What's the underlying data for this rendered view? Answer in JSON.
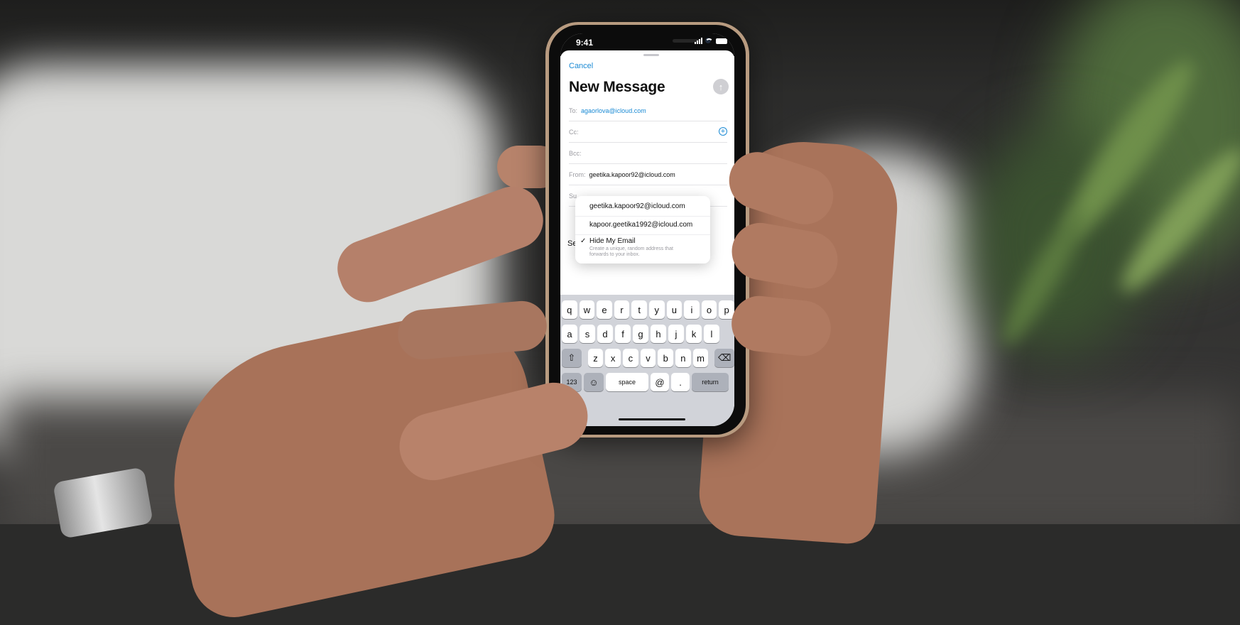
{
  "status_bar": {
    "time": "9:41"
  },
  "compose": {
    "cancel_label": "Cancel",
    "title": "New Message",
    "send_icon": "arrow-up-icon",
    "to_label": "To:",
    "to_value": "agaorlova@icloud.com",
    "cc_label": "Cc:",
    "bcc_label": "Bcc:",
    "from_label": "From:",
    "from_value": "geetika.kapoor92@icloud.com",
    "subject_label": "Su",
    "body_stub": "Se"
  },
  "from_menu": {
    "options": [
      {
        "label": "geetika.kapoor92@icloud.com"
      },
      {
        "label": "kapoor.geetika1992@icloud.com"
      },
      {
        "label": "Hide My Email",
        "description": "Create a unique, random address that forwards to your inbox.",
        "checked": true
      }
    ]
  },
  "keyboard": {
    "row1": [
      "q",
      "w",
      "e",
      "r",
      "t",
      "y",
      "u",
      "i",
      "o",
      "p"
    ],
    "row2": [
      "a",
      "s",
      "d",
      "f",
      "g",
      "h",
      "j",
      "k",
      "l"
    ],
    "row3": [
      "z",
      "x",
      "c",
      "v",
      "b",
      "n",
      "m"
    ],
    "numbers_label": "123",
    "space_label": "space",
    "at_label": "@",
    "dot_label": ".",
    "return_label": "return"
  },
  "colors": {
    "accent": "#1a8ad4",
    "keyboard_bg": "#d1d3d9"
  }
}
